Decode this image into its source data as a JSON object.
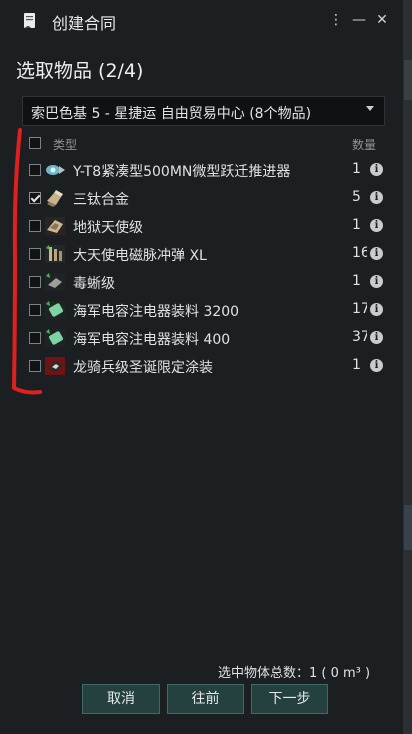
{
  "window": {
    "title": "创建合同",
    "menu_icon": "kebab-menu-icon",
    "minimize_icon": "minimize-icon",
    "close_icon": "close-icon"
  },
  "heading": "选取物品 (2/4)",
  "location_dropdown": {
    "selected": "索巴色基 5 - 星捷运 自由贸易中心 (8个物品)"
  },
  "list": {
    "header_type": "类型",
    "header_qty": "数量",
    "items": [
      {
        "name": "Y-T8紧凑型500MN微型跃迁推进器",
        "qty": "1",
        "checked": false,
        "icon": "microwarpdrive-icon"
      },
      {
        "name": "三钛合金",
        "qty": "5",
        "checked": true,
        "icon": "tritanium-icon"
      },
      {
        "name": "地狱天使级",
        "qty": "1",
        "checked": false,
        "icon": "ship-icon"
      },
      {
        "name": "大天使电磁脉冲弹 XL",
        "qty": "16",
        "checked": false,
        "icon": "ammo-icon"
      },
      {
        "name": "毒蜥级",
        "qty": "1",
        "checked": false,
        "icon": "ship-icon"
      },
      {
        "name": "海军电容注电器装料 3200",
        "qty": "17",
        "checked": false,
        "icon": "cap-booster-icon"
      },
      {
        "name": "海军电容注电器装料 400",
        "qty": "37",
        "checked": false,
        "icon": "cap-booster-icon"
      },
      {
        "name": "龙骑兵级圣诞限定涂装",
        "qty": "1",
        "checked": false,
        "icon": "skin-icon"
      }
    ]
  },
  "summary": "选中物体总数：1 ( 0 m³ )",
  "buttons": {
    "cancel": "取消",
    "back": "往前",
    "next": "下一步"
  },
  "colors": {
    "background": "#1c1f22",
    "button": "#24403f",
    "annotation": "#e0201f"
  }
}
